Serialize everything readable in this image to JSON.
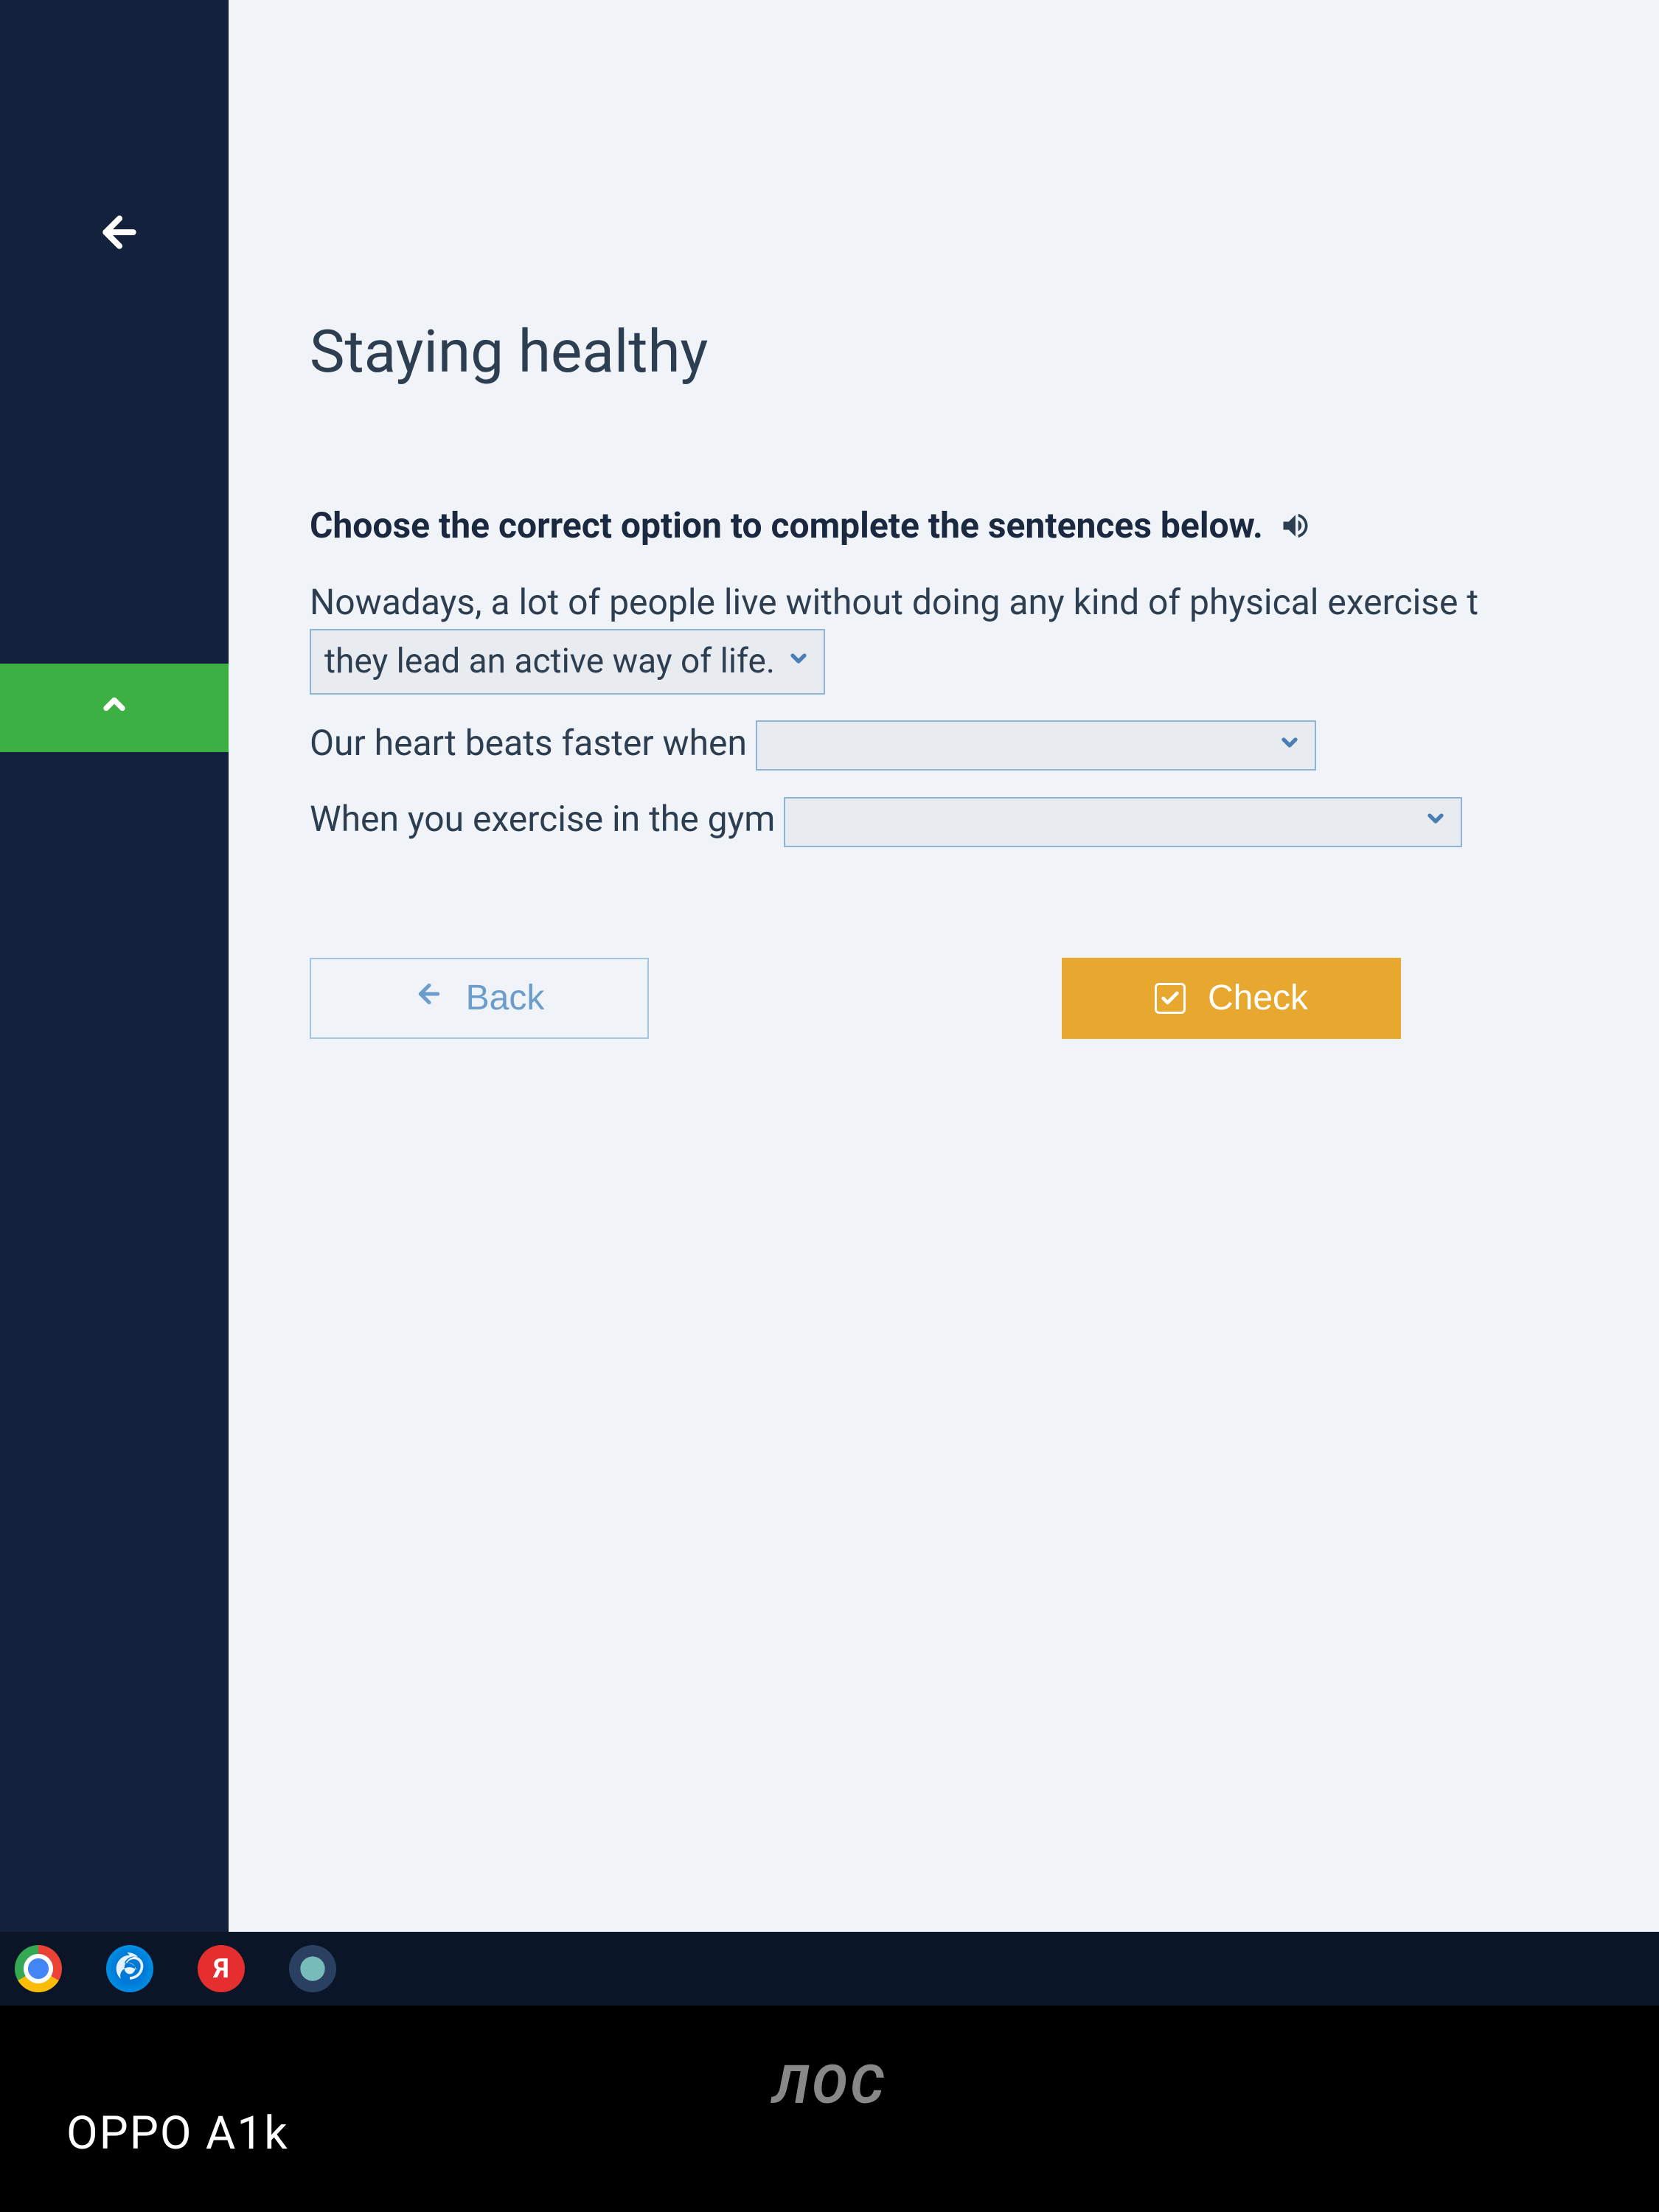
{
  "sidebar": {
    "back_icon": "arrow-left"
  },
  "page": {
    "title": "Staying healthy",
    "instruction": "Choose the correct option to complete the sentences below."
  },
  "sentences": [
    {
      "text_before": "Nowadays, a lot of people live without doing any kind of physical exercise t",
      "dropdown_value": "they lead an active way of life.",
      "text_after": ""
    },
    {
      "text_before": "Our heart beats faster when",
      "dropdown_value": "",
      "text_after": ""
    },
    {
      "text_before": "When you exercise in the gym",
      "dropdown_value": "",
      "text_after": ""
    }
  ],
  "buttons": {
    "back": "Back",
    "check": "Check"
  },
  "taskbar": {
    "yandex_label": "Я"
  },
  "monitor_brand": "ЛOC",
  "watermark": "OPPO A1k"
}
